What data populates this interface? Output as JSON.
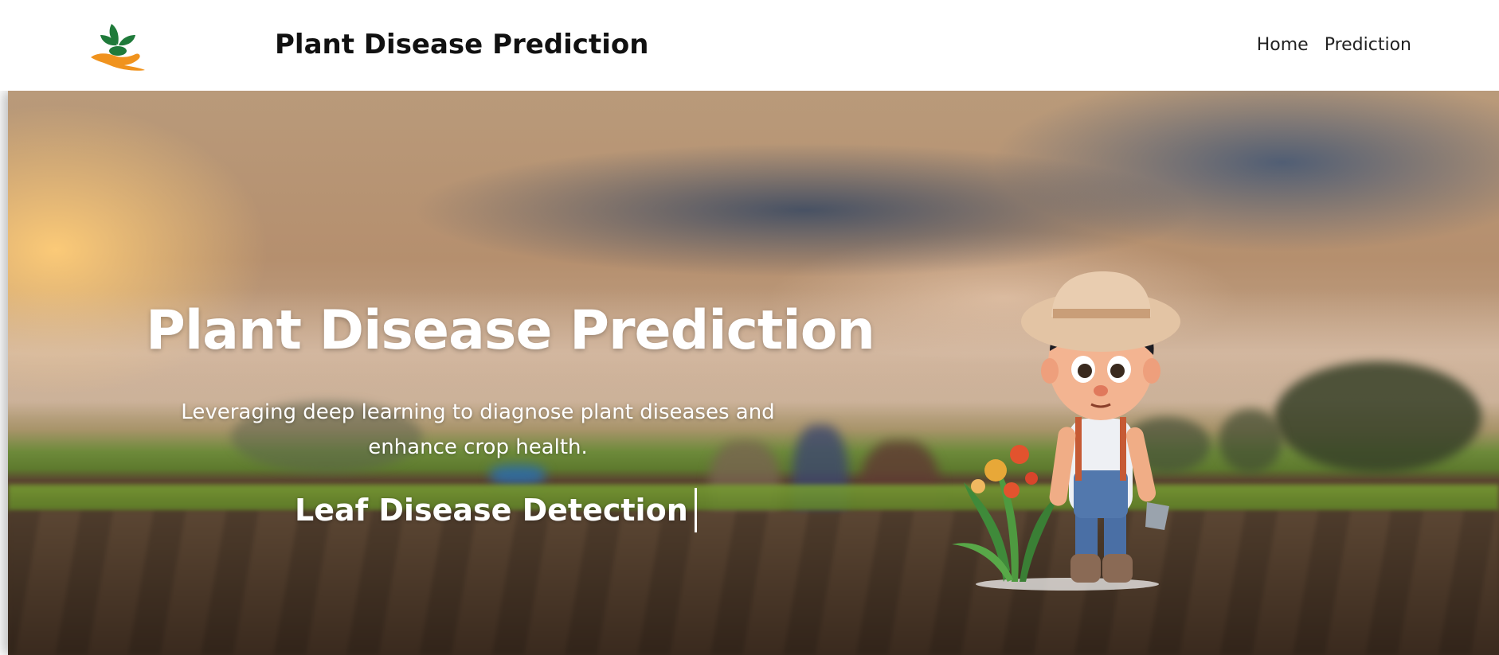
{
  "header": {
    "brand_title": "Plant Disease Prediction",
    "logo_icon": "plant-in-hand-icon",
    "nav": [
      {
        "label": "Home"
      },
      {
        "label": "Prediction"
      }
    ]
  },
  "hero": {
    "title": "Plant Disease Prediction",
    "subtitle": "Leveraging deep learning to diagnose plant diseases and enhance crop health.",
    "typed_text": "Leaf Disease Detection",
    "illustration": "farmer-boy-with-plant"
  },
  "colors": {
    "logo_green": "#1f7a3a",
    "logo_orange": "#f0931e",
    "text_white": "#ffffff",
    "nav_text": "#222222"
  }
}
